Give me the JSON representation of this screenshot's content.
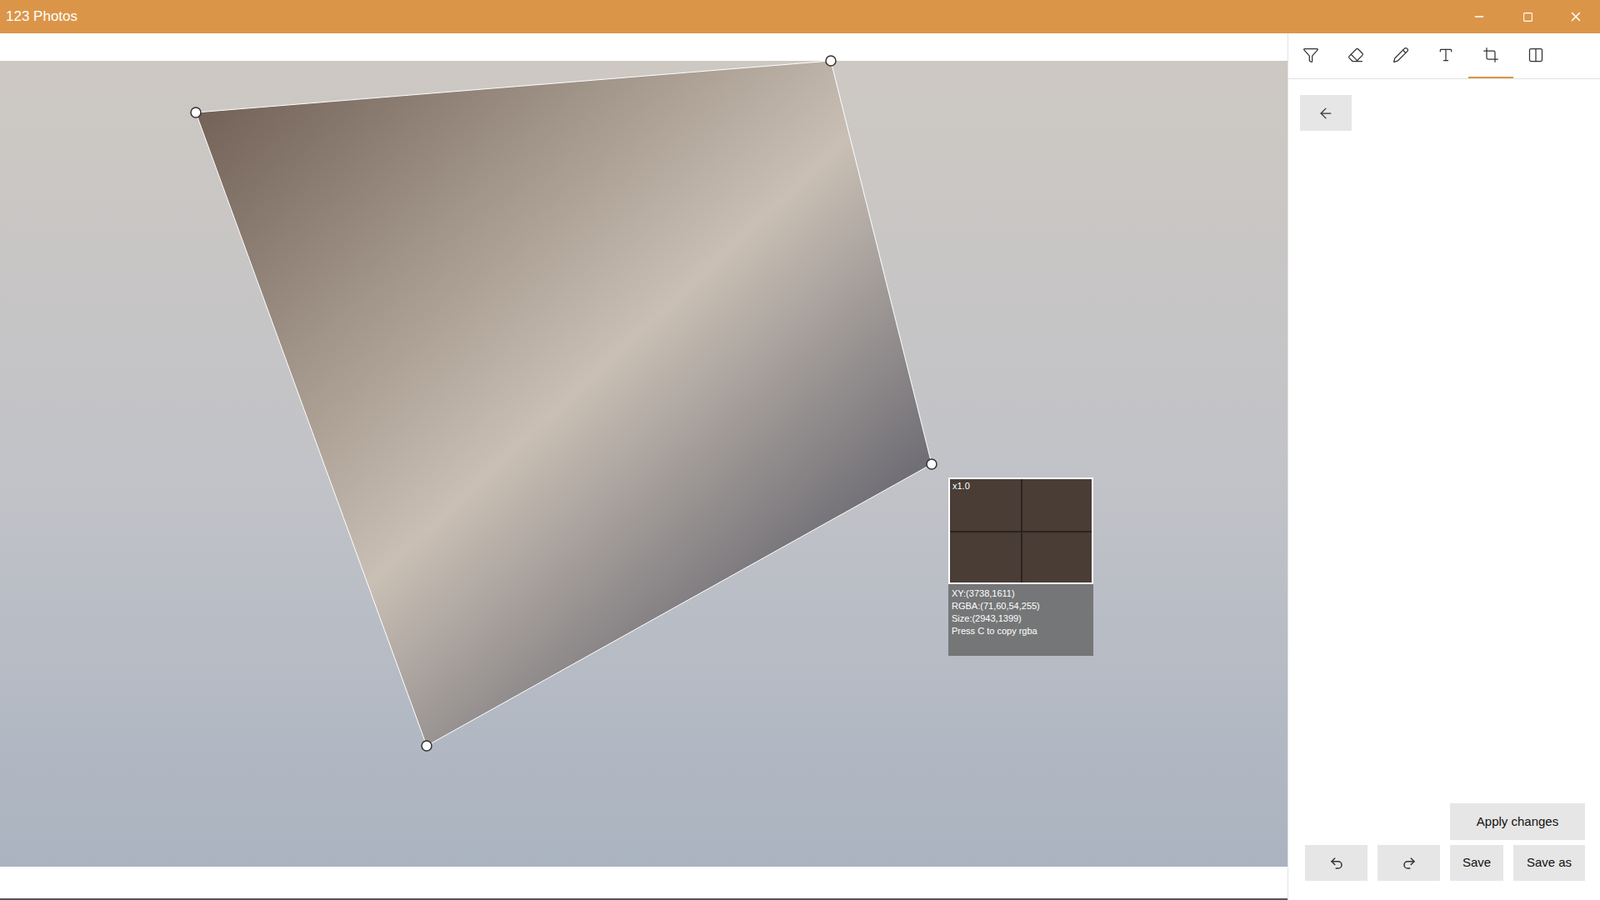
{
  "window": {
    "title": "123 Photos"
  },
  "toolbar": {
    "tools": [
      {
        "kind": "filter",
        "selected": false
      },
      {
        "kind": "eraser",
        "selected": false
      },
      {
        "kind": "pencil",
        "selected": false
      },
      {
        "kind": "text",
        "selected": false
      },
      {
        "kind": "crop",
        "selected": true
      },
      {
        "kind": "layout",
        "selected": false
      }
    ]
  },
  "magnifier": {
    "zoom": "x1.0",
    "lines": [
      "XY:(3738,1611)",
      "RGBA:(71,60,54,255)",
      "Size:(2943,1399)",
      "Press C to copy rgba"
    ]
  },
  "actions": {
    "apply": "Apply changes",
    "save": "Save",
    "save_as": "Save as"
  }
}
